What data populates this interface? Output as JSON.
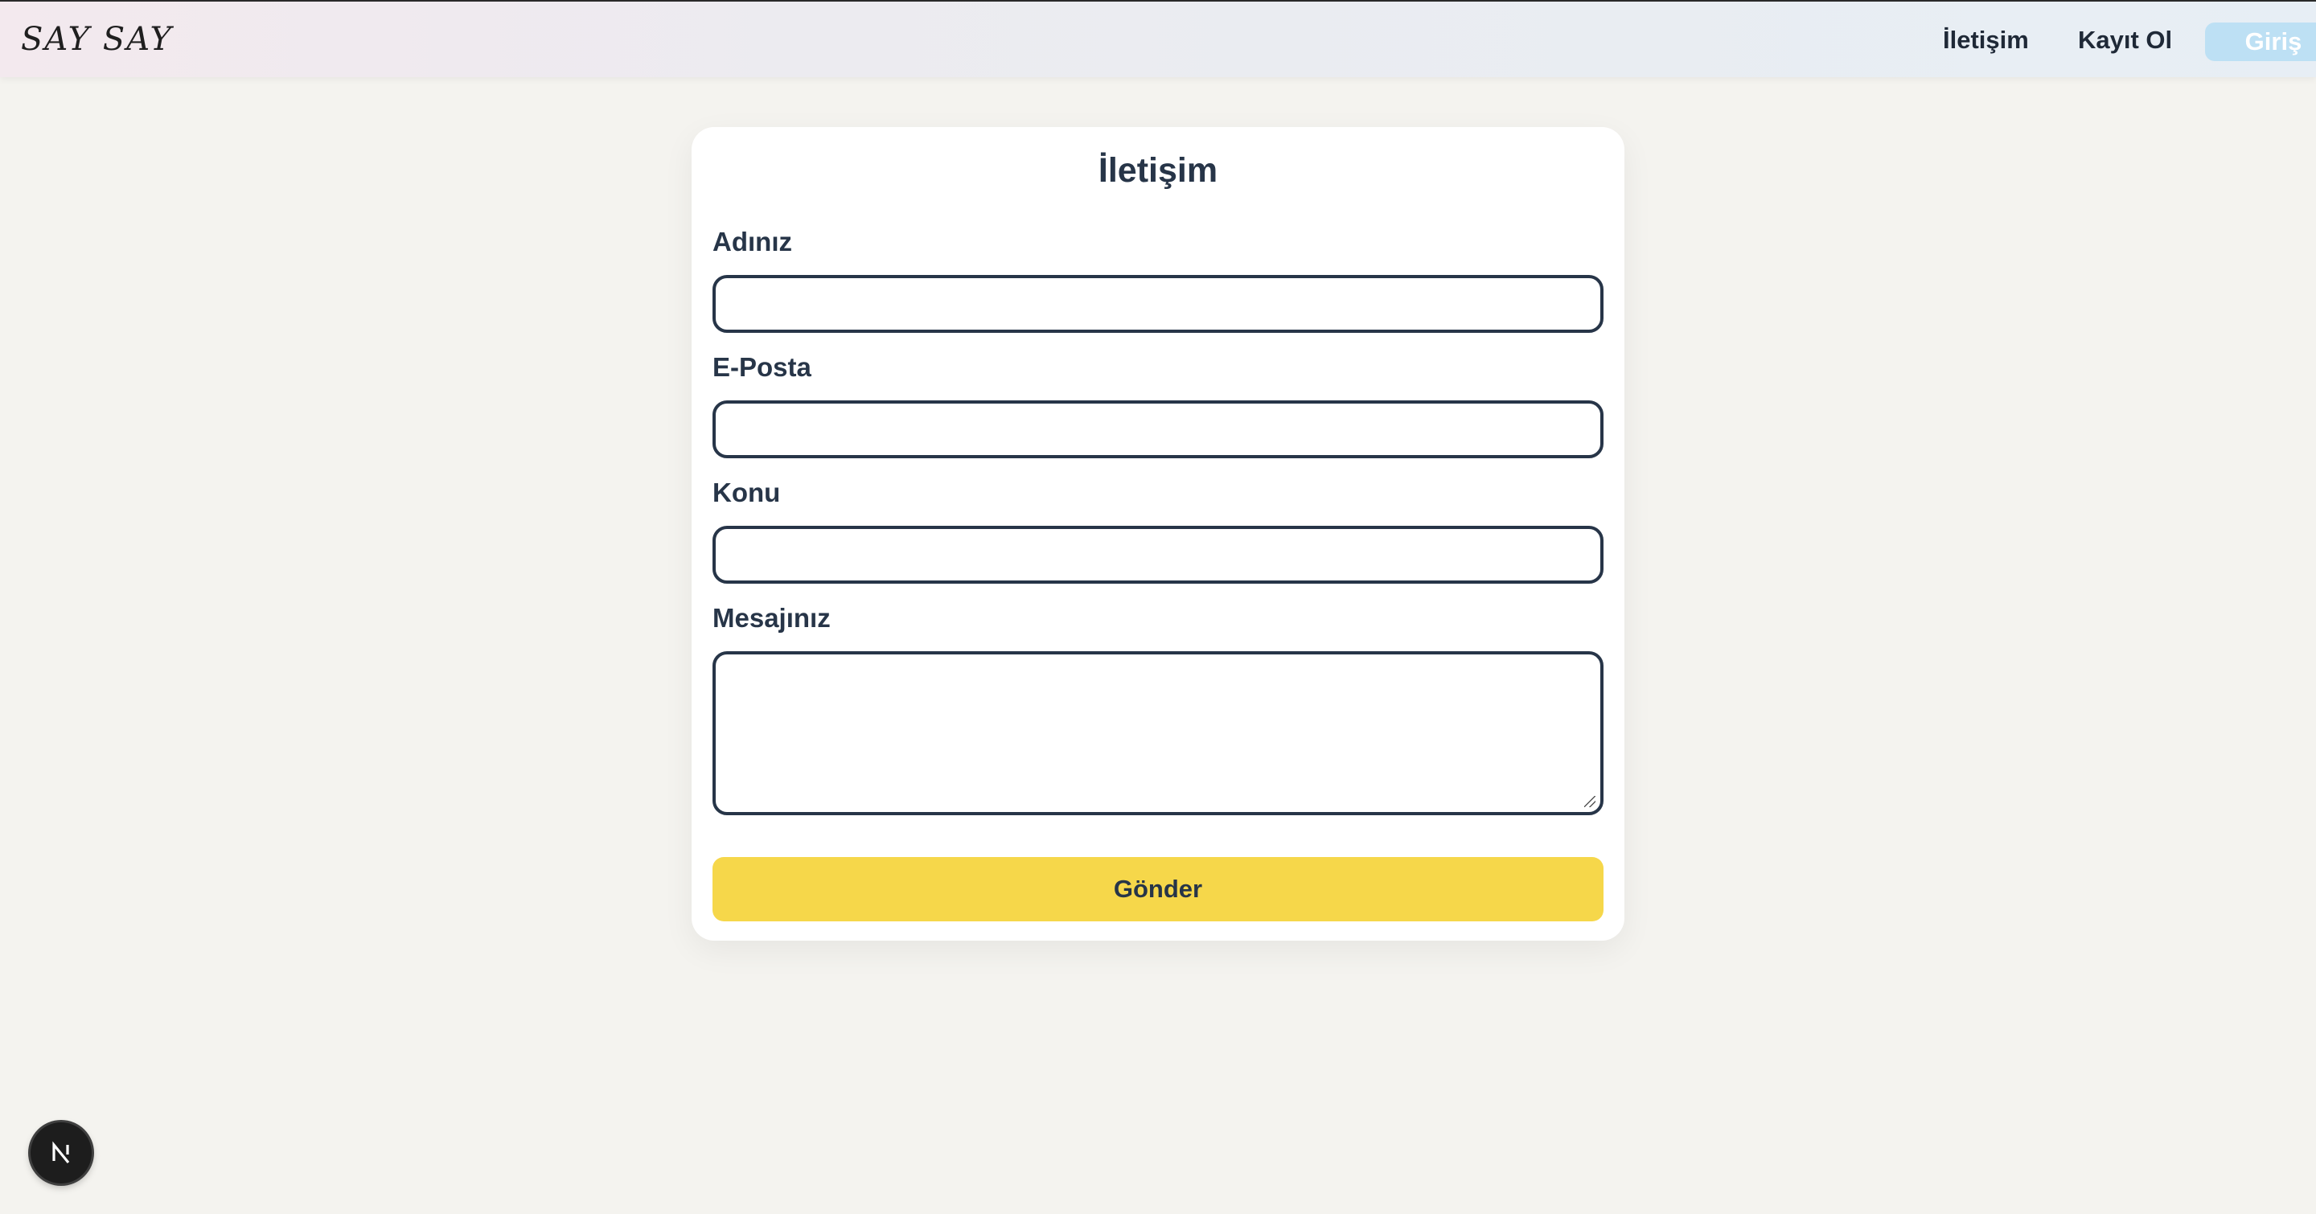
{
  "navbar": {
    "logo": "SAY SAY",
    "links": {
      "contact": "İletişim",
      "register": "Kayıt Ol",
      "login": "Giriş"
    }
  },
  "form": {
    "title": "İletişim",
    "fields": [
      {
        "label": "Adınız",
        "value": "",
        "type": "text"
      },
      {
        "label": "E-Posta",
        "value": "",
        "type": "email"
      },
      {
        "label": "Konu",
        "value": "",
        "type": "text"
      },
      {
        "label": "Mesajınız",
        "value": "",
        "type": "textarea"
      }
    ],
    "submit_label": "Gönder"
  },
  "colors": {
    "background": "#f4f3ef",
    "accent_button": "#f6d74a",
    "login_button": "#bde0f4",
    "text_primary": "#273548"
  },
  "icons": {
    "dev_badge": "nextjs-icon"
  }
}
